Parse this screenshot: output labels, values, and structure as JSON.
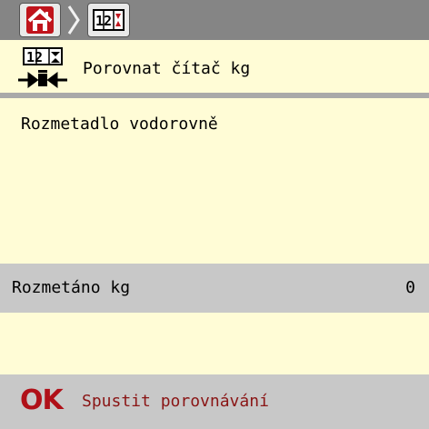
{
  "breadcrumb": {
    "home_icon": "home-icon",
    "separator_icon": "chevron-right-icon",
    "current_icon": "counter-icon",
    "current_icon_text": "12"
  },
  "header": {
    "icon": "calibrate-counter-icon",
    "icon_text": "12",
    "title": "Porovnat čítač kg"
  },
  "main": {
    "message": "Rozmetadlo vodorovně"
  },
  "value_row": {
    "label": "Rozmetáno kg",
    "value": "0"
  },
  "softkey": {
    "ok_label": "OK",
    "action_label": "Spustit porovnávání",
    "ok_color": "#b01018",
    "label_color": "#8a1515"
  },
  "colors": {
    "background": "#fffcd6",
    "topbar": "#858585",
    "panel": "#c8c8c8",
    "home_red": "#c0141c"
  }
}
